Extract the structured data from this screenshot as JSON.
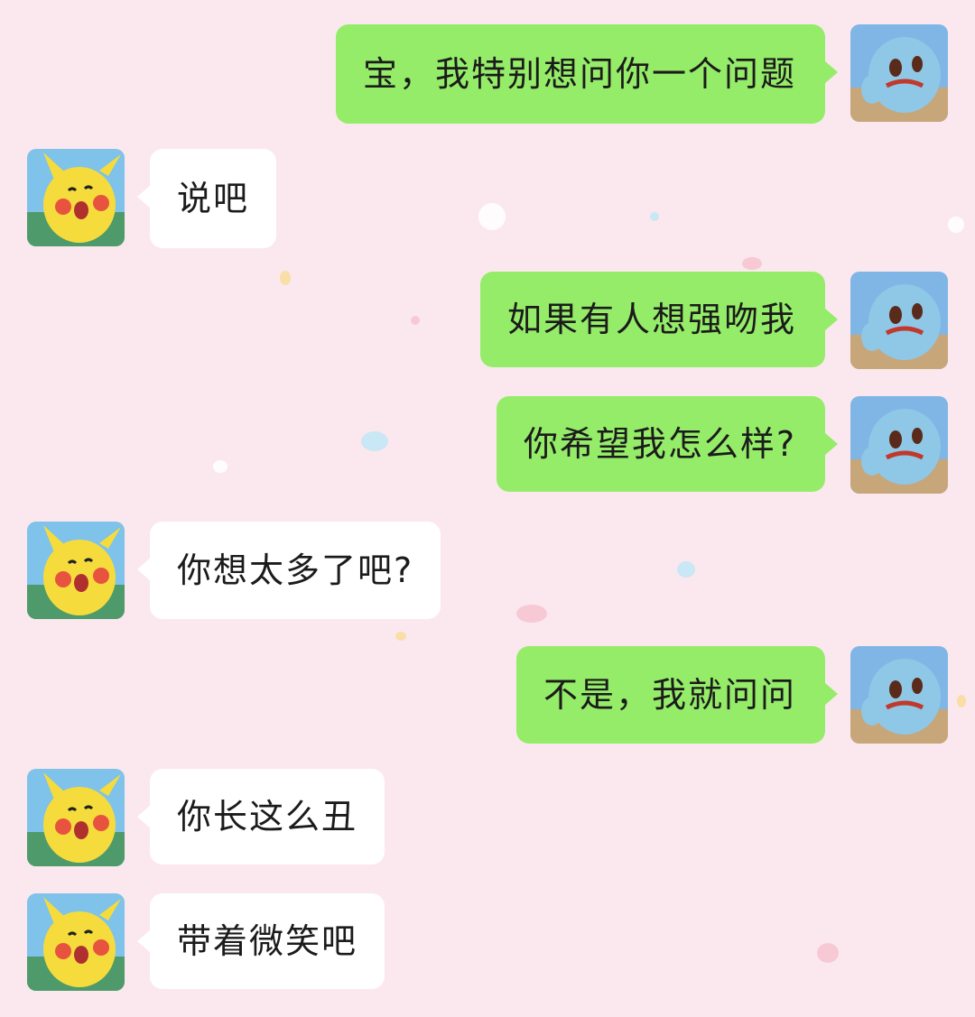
{
  "chat": {
    "me_avatar_icon": "squirtle-avatar-icon",
    "them_avatar_icon": "pikachu-avatar-icon",
    "colors": {
      "background": "#fbe8ee",
      "me_bubble": "#95ec69",
      "them_bubble": "#ffffff"
    },
    "messages": [
      {
        "sender": "me",
        "text": "宝，我特别想问你一个问题"
      },
      {
        "sender": "them",
        "text": "说吧"
      },
      {
        "sender": "me",
        "text": "如果有人想强吻我"
      },
      {
        "sender": "me",
        "text": "你希望我怎么样?"
      },
      {
        "sender": "them",
        "text": "你想太多了吧?"
      },
      {
        "sender": "me",
        "text": "不是，我就问问"
      },
      {
        "sender": "them",
        "text": "你长这么丑"
      },
      {
        "sender": "them",
        "text": "带着微笑吧"
      }
    ]
  }
}
